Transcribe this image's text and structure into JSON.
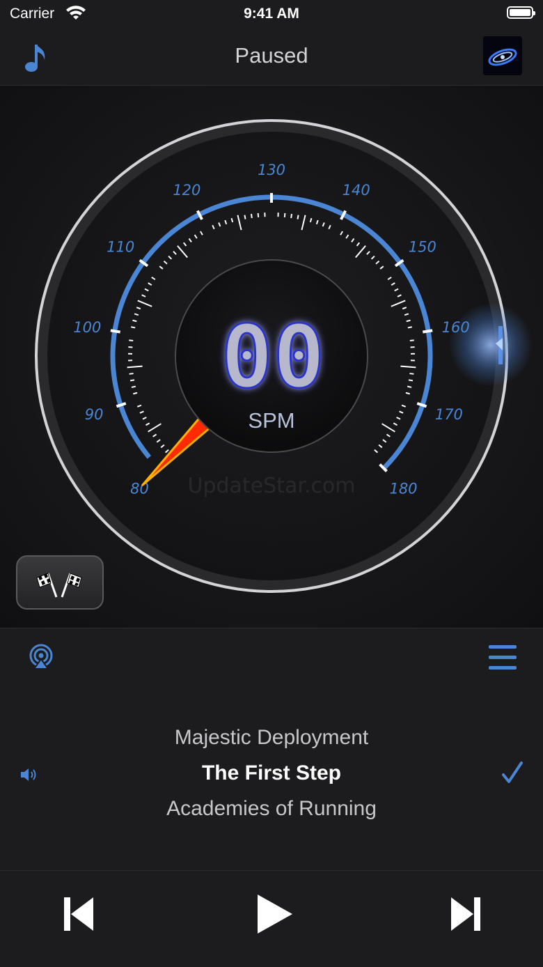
{
  "status_bar": {
    "carrier": "Carrier",
    "time": "9:41 AM"
  },
  "nav": {
    "title": "Paused",
    "left_icon": "music-note-icon",
    "right_icon": "album-art-thumbnail"
  },
  "gauge": {
    "display_value": "00",
    "unit": "SPM",
    "tick_labels": [
      "80",
      "90",
      "100",
      "110",
      "120",
      "130",
      "140",
      "150",
      "160",
      "170",
      "180"
    ],
    "min": 80,
    "max": 180,
    "needle_value": 80,
    "accent_color": "#4a86d4",
    "needle_color": "#ff2a00",
    "watermark": "UpdateStar.com"
  },
  "toolbar": {
    "airplay_icon": "airplay-icon",
    "list_icon": "list-icon",
    "race_icon": "checkered-flags-icon"
  },
  "playlist": {
    "previous": "Majestic Deployment",
    "current": "The First Step",
    "next": "Academies of Running",
    "speaker_icon": "speaker-icon",
    "check_icon": "checkmark-icon"
  },
  "controls": {
    "prev_icon": "skip-back-icon",
    "play_icon": "play-icon",
    "next_icon": "skip-forward-icon"
  }
}
